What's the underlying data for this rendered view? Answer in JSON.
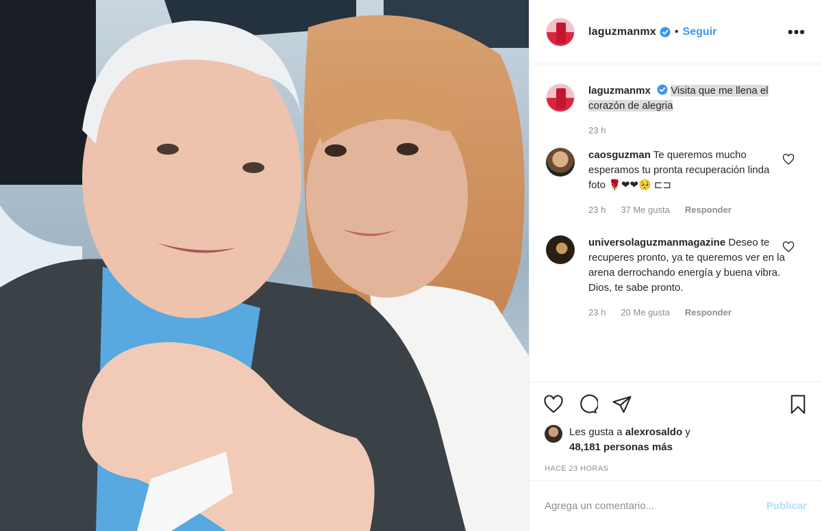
{
  "post": {
    "image_description_icon": "photo",
    "username": "laguzmanmx",
    "follow_label": "Seguir",
    "separator": "•",
    "more_label": "•••"
  },
  "caption": {
    "username": "laguzmanmx",
    "text": "Visita que me llena el corazón de alegria",
    "time": "23 h"
  },
  "comments": [
    {
      "username": "caosguzman",
      "text": "Te queremos mucho esperamos tu pronta recuperación linda foto 🌹❤❤🥺 ⊏⊐",
      "time": "23 h",
      "likes": "37 Me gusta",
      "reply": "Responder"
    },
    {
      "username": "universolaguzmanmagazine",
      "text": "Deseo te recuperes pronto, ya te queremos ver en la arena derrochando energía y buena vibra. Dios, te sabe pronto.",
      "time": "23 h",
      "likes": "20 Me gusta",
      "reply": "Responder"
    }
  ],
  "likes": {
    "prefix": "Les gusta a ",
    "user": "alexrosaldo",
    "suffix": " y",
    "others": "48,181 personas más"
  },
  "timestamp": "HACE 23 HORAS",
  "add_comment": {
    "placeholder": "Agrega un comentario...",
    "publish_label": "Publicar"
  },
  "colors": {
    "accent": "#3897f0",
    "publish_disabled": "#b2dffc",
    "muted": "#8e8e8e",
    "text": "#262626"
  }
}
